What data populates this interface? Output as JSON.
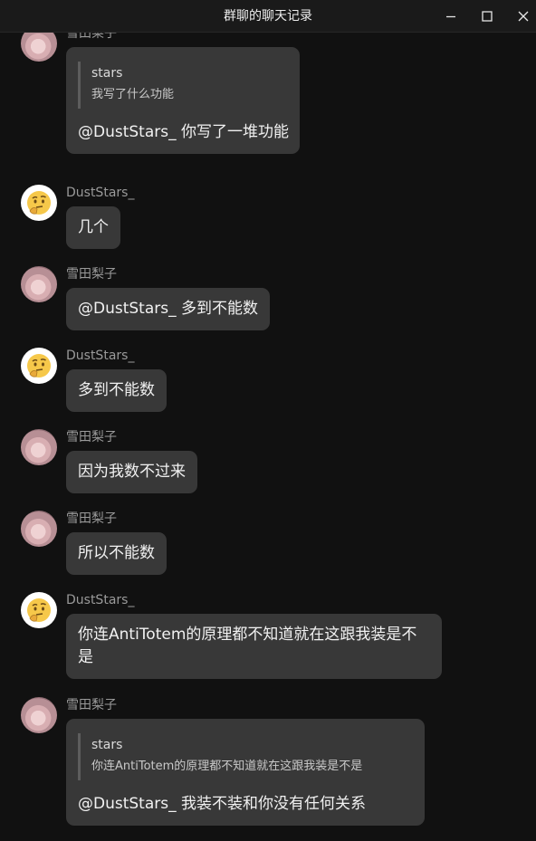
{
  "window": {
    "title": "群聊的聊天记录"
  },
  "messages": [
    {
      "sender": "雪田梨子",
      "quote_name": "stars",
      "quote_text": "我写了什么功能",
      "text": "@DustStars_ 你写了一堆功能"
    },
    {
      "sender": "DustStars_",
      "text": "几个"
    },
    {
      "sender": "雪田梨子",
      "text": "@DustStars_ 多到不能数"
    },
    {
      "sender": "DustStars_",
      "text": "多到不能数"
    },
    {
      "sender": "雪田梨子",
      "text": "因为我数不过来"
    },
    {
      "sender": "雪田梨子",
      "text": "所以不能数"
    },
    {
      "sender": "DustStars_",
      "text": "你连AntiTotem的原理都不知道就在这跟我装是不是"
    },
    {
      "sender": "雪田梨子",
      "quote_name": "stars",
      "quote_text": "你连AntiTotem的原理都不知道就在这跟我装是不是",
      "text": "@DustStars_ 我装不装和你没有任何关系"
    }
  ]
}
